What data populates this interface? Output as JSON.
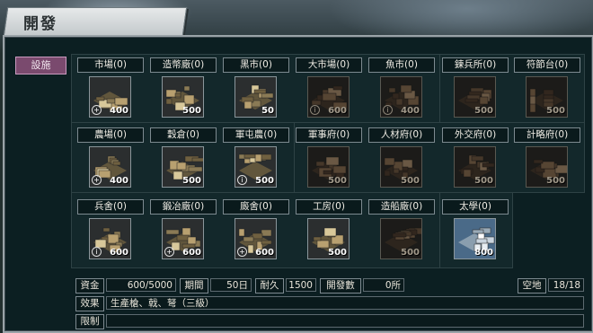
{
  "window": {
    "title": "開發"
  },
  "sidebar": {
    "facilities_tab": "設施"
  },
  "buildings": [
    {
      "label": "市場(0)",
      "cost": "400",
      "mark": "+",
      "state": "available",
      "icon": "market-icon"
    },
    {
      "label": "造幣廠(0)",
      "cost": "500",
      "mark": "",
      "state": "available",
      "icon": "mint-icon"
    },
    {
      "label": "黑市(0)",
      "cost": "50",
      "mark": "",
      "state": "available",
      "icon": "black-market-icon"
    },
    {
      "label": "大市場(0)",
      "cost": "600",
      "mark": "i",
      "state": "locked",
      "icon": "grand-market-icon"
    },
    {
      "label": "魚市(0)",
      "cost": "400",
      "mark": "i",
      "state": "locked",
      "icon": "fish-market-icon"
    },
    {
      "label": "鍊兵所(0)",
      "cost": "500",
      "mark": "",
      "state": "locked",
      "icon": "training-ground-icon"
    },
    {
      "label": "符節台(0)",
      "cost": "500",
      "mark": "",
      "state": "locked",
      "icon": "tally-platform-icon"
    },
    {
      "label": "農場(0)",
      "cost": "400",
      "mark": "+",
      "state": "available",
      "icon": "farm-icon"
    },
    {
      "label": "穀倉(0)",
      "cost": "500",
      "mark": "",
      "state": "available",
      "icon": "granary-icon"
    },
    {
      "label": "軍屯農(0)",
      "cost": "500",
      "mark": "i",
      "state": "available",
      "icon": "military-farm-icon"
    },
    {
      "label": "軍事府(0)",
      "cost": "500",
      "mark": "",
      "state": "locked",
      "icon": "military-office-icon"
    },
    {
      "label": "人材府(0)",
      "cost": "500",
      "mark": "",
      "state": "locked",
      "icon": "talent-office-icon"
    },
    {
      "label": "外交府(0)",
      "cost": "500",
      "mark": "",
      "state": "locked",
      "icon": "diplomacy-office-icon"
    },
    {
      "label": "計略府(0)",
      "cost": "500",
      "mark": "",
      "state": "locked",
      "icon": "strategy-office-icon"
    },
    {
      "label": "兵舍(0)",
      "cost": "600",
      "mark": "i",
      "state": "available",
      "icon": "barracks-icon"
    },
    {
      "label": "鍛冶廠(0)",
      "cost": "600",
      "mark": "+",
      "state": "available",
      "icon": "smithy-icon"
    },
    {
      "label": "廄舍(0)",
      "cost": "600",
      "mark": "+",
      "state": "available",
      "icon": "stable-icon"
    },
    {
      "label": "工房(0)",
      "cost": "500",
      "mark": "",
      "state": "available",
      "icon": "workshop-icon"
    },
    {
      "label": "造船廠(0)",
      "cost": "500",
      "mark": "",
      "state": "locked",
      "icon": "shipyard-icon"
    },
    {
      "label": "太學(0)",
      "cost": "800",
      "mark": "",
      "state": "special",
      "icon": "academy-icon"
    }
  ],
  "info": {
    "funds_label": "資金",
    "funds_value": "600/5000",
    "period_label": "期間",
    "period_value": "50日",
    "durability_label": "耐久",
    "durability_value": "1500",
    "dev_count_label": "開發數",
    "dev_count_value": "0所",
    "vacant_label": "空地",
    "vacant_value": "18/18",
    "effect_label": "效果",
    "effect_value": "生產槍、戟、弩（三級）",
    "limit_label": "限制",
    "limit_value": ""
  }
}
